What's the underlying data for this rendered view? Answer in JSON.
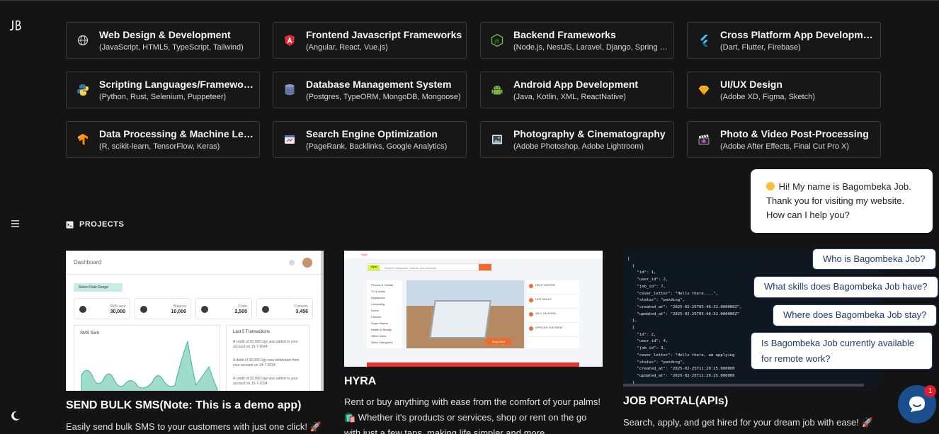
{
  "skills": [
    {
      "title": "Web Design & Development",
      "sub": "(JavaScript, HTML5, TypeScript, Tailwind)",
      "icon": "globe-icon"
    },
    {
      "title": "Frontend Javascript Frameworks",
      "sub": "(Angular, React, Vue.js)",
      "icon": "angular-icon"
    },
    {
      "title": "Backend Frameworks",
      "sub": "(Node.js, NestJS, Laravel, Django, Spring Bo...",
      "icon": "nodejs-icon"
    },
    {
      "title": "Cross Platform App Development",
      "sub": "(Dart, Flutter, Firebase)",
      "icon": "flutter-icon"
    },
    {
      "title": "Scripting Languages/Frameworks",
      "sub": "(Python, Rust, Selenium, Puppeteer)",
      "icon": "python-icon"
    },
    {
      "title": "Database Management System",
      "sub": "(Postgres, TypeORM, MongoDB, Mongoose)",
      "icon": "database-icon"
    },
    {
      "title": "Android App Development",
      "sub": "(Java, Kotlin, XML, ReactNative)",
      "icon": "android-icon"
    },
    {
      "title": "UI/UX Design",
      "sub": "(Adobe XD, Figma, Sketch)",
      "icon": "diamond-icon"
    },
    {
      "title": "Data Processing & Machine Learni...",
      "sub": "(R, scikit-learn, TensorFlow, Keras)",
      "icon": "tensorflow-icon"
    },
    {
      "title": "Search Engine Optimization",
      "sub": "(PageRank, Backlinks, Google Analytics)",
      "icon": "seo-icon"
    },
    {
      "title": "Photography & Cinematography",
      "sub": "(Adobe Photoshop, Adobe Lightroom)",
      "icon": "photo-icon"
    },
    {
      "title": "Photo & Video Post-Processing",
      "sub": "(Adobe After Effects, Final Cut Pro X)",
      "icon": "clapper-icon"
    }
  ],
  "projects_heading": "PROJECTS",
  "projects": [
    {
      "title": "SEND BULK SMS(Note: This is a demo app)",
      "desc": "Easily send bulk SMS to your customers with just one click! 🚀"
    },
    {
      "title": "HYRA",
      "desc": "Rent or buy anything with ease from the comfort of your palms! 🛍️ Whether it's products or services, shop or rent on the go with just a few taps, making life simpler and more"
    },
    {
      "title": "JOB PORTAL(APIs)",
      "desc": "Search, apply, and get hired for your dream job with ease! 🚀"
    }
  ],
  "dashboard": {
    "header": "Dashboard",
    "button": "Select Date Range",
    "stats": [
      {
        "label": "SMS sent",
        "value": "30,000"
      },
      {
        "label": "Balance",
        "value": "10,000"
      },
      {
        "label": "Costs",
        "value": "2,500"
      },
      {
        "label": "Contacts",
        "value": "3,456"
      }
    ],
    "chart_title": "SMS Sent",
    "tx_title": "Last 5 Transactions",
    "tx": [
      "A credit of 30,000 Ugx was added to your account on 15-7-2024",
      "A debit of 30,000 Ugx was withdrawn from your account on 14-7-2024",
      "A credit of 10,000 Ugx was added to your account on 15-7-2024"
    ]
  },
  "hyra": {
    "brand": "Hyra",
    "search_placeholder": "Search Categories, brands, and products",
    "categories": [
      "Phones & Tablets",
      "TV & Audio",
      "Appliances",
      "Computing",
      "Home",
      "Fashion",
      "Super Market",
      "Health & Beauty",
      "Office Items",
      "Other Categories"
    ],
    "side": [
      "HELP CENTER",
      "HOT DEALS",
      "SELL ON HYRA",
      "OFFICES FOR RENT"
    ],
    "shop_now": "Shop Now"
  },
  "json_code": "[\n  {\n    \"id\": 1,\n    \"user_id\": 2,\n    \"job_id\": 7,\n    \"cover_letter\": \"Hello there....\",\n    \"status\": \"pending\",\n    \"created_at\": \"2025-02-25T05:46:32.000000Z\",\n    \"updated_at\": \"2025-02-25T05:46:32.000000Z\"\n  },\n  {\n    \"id\": 2,\n    \"user_id\": 4,\n    \"job_id\": 3,\n    \"cover_letter\": \"Hello there, am applying\n    \"status\": \"pending\",\n    \"created_at\": \"2025-02-25T11:20:25.000000\n    \"updated_at\": \"2025-02-25T11:20:25.000000\n  }\n]",
  "chat": {
    "greeting": "Hi! My name is Bagombeka Job. Thank you for visiting my website. How can I help you?",
    "options": [
      "Who is Bagombeka Job?",
      "What skills does Bagombeka Job have?",
      "Where does Bagombeka Job stay?",
      "Is Bagombeka Job currently available for remote work?"
    ],
    "badge": "1"
  }
}
